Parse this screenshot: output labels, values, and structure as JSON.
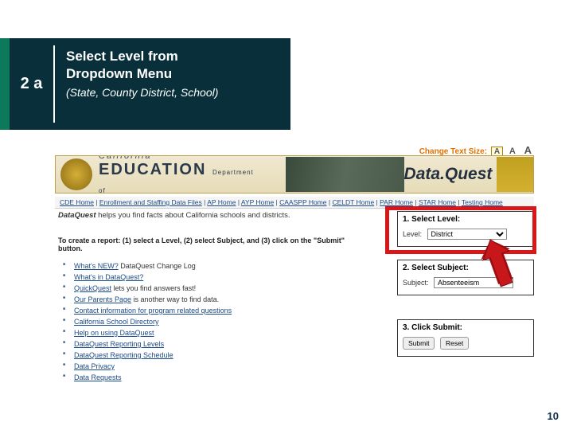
{
  "step": {
    "number": "2 a",
    "title_l1": "Select Level from",
    "title_l2": "Dropdown Menu",
    "subtitle": "(State, County District, School)"
  },
  "textsize": {
    "label": "Change Text Size:",
    "a1": "A",
    "a2": "A",
    "a3": "A"
  },
  "banner": {
    "state": "California",
    "dept": "Department of",
    "word": "EDUCATION",
    "dataquest": "Data.Quest"
  },
  "breadcrumb": {
    "sep": " | ",
    "items": [
      "CDE Home",
      "Enrollment and Staffing Data Files",
      "AP Home",
      "AYP Home",
      "CAASPP Home",
      "CELDT Home",
      "PAR Home",
      "STAR Home",
      "Testing Home"
    ]
  },
  "intro": {
    "bold": "DataQuest",
    "rest": " helps you find facts about California schools and districts."
  },
  "instructions": "To create a report: (1) select a Level, (2) select Subject, and (3) click on the \"Submit\" button.",
  "bullets": [
    {
      "link": "What's NEW?",
      "tail": " DataQuest Change Log"
    },
    {
      "link": "What's in DataQuest?",
      "tail": ""
    },
    {
      "link": "QuickQuest",
      "tail": " lets you find answers fast!"
    },
    {
      "link": "Our Parents Page",
      "tail": " is another way to find data."
    },
    {
      "link": "Contact information for program related questions",
      "tail": ""
    },
    {
      "link": "California School Directory",
      "tail": ""
    },
    {
      "link": "Help on using DataQuest",
      "tail": ""
    },
    {
      "link": "DataQuest Reporting Levels",
      "tail": ""
    },
    {
      "link": "DataQuest Reporting Schedule",
      "tail": ""
    },
    {
      "link": "Data Privacy",
      "tail": ""
    },
    {
      "link": "Data Requests",
      "tail": ""
    }
  ],
  "panel1": {
    "header": "1. Select Level:",
    "label": "Level:",
    "value": "District"
  },
  "panel2": {
    "header": "2. Select Subject:",
    "label": "Subject:",
    "value": "Absenteeism"
  },
  "panel3": {
    "header": "3. Click Submit:",
    "submit": "Submit",
    "reset": "Reset"
  },
  "page_number": "10"
}
